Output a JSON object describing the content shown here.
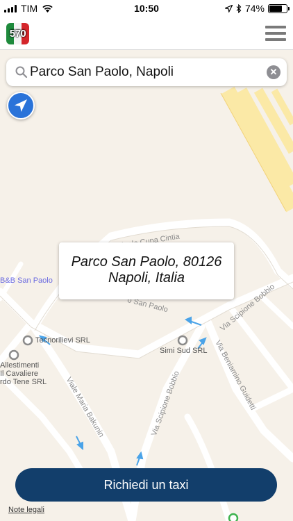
{
  "status_bar": {
    "carrier": "TIM",
    "time": "10:50",
    "battery": "74%",
    "battery_level": 0.74
  },
  "header": {
    "logo_text": "570",
    "menu_icon": "hamburger-menu-icon"
  },
  "search": {
    "value": "Parco San Paolo, Napoli",
    "search_icon": "search-icon",
    "clear_icon": "clear-icon"
  },
  "map": {
    "locate_icon": "location-arrow-icon",
    "popup_line1": "Parco San Paolo, 80126",
    "popup_line2": "Napoli, Italia",
    "pois": [
      "B&B San Paolo",
      "Tecnorilievi SRL",
      "Simi Sud SRL",
      "Allestimenti",
      "Il Cavaliere",
      "rdo Tene SRL"
    ],
    "streets": [
      "Vicinale Cupa Cintia",
      "o San Paolo",
      "Via Scipione Bobbio",
      "Via Scipione Bobbio",
      "Viale Maria Bakunin",
      "Via Beniamino Guidetti"
    ]
  },
  "cta": {
    "label": "Richiedi un taxi"
  },
  "footer": {
    "legal": "Note legali"
  },
  "colors": {
    "accent": "#123e6b",
    "locate": "#2a73d9",
    "map_bg": "#f6f1e9"
  }
}
